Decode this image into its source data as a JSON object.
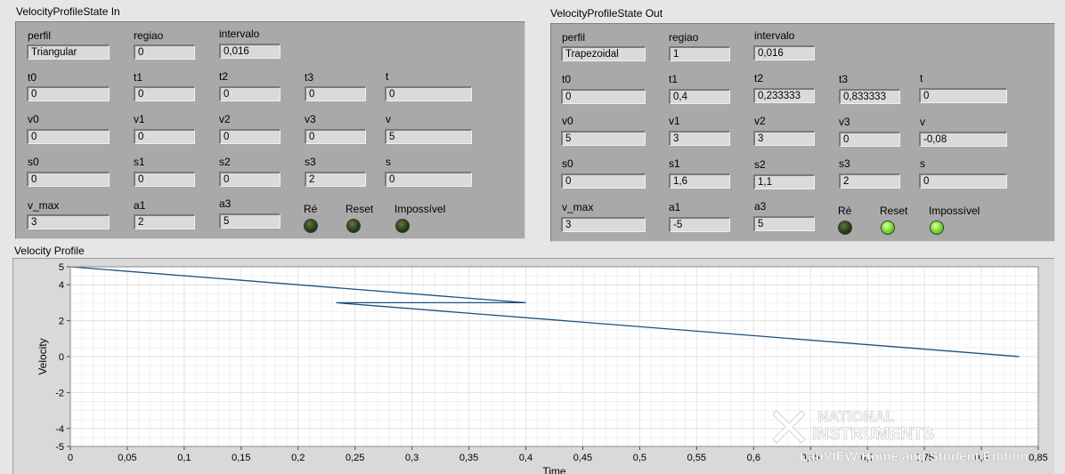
{
  "in": {
    "title": "VelocityProfileState In",
    "labels": {
      "perfil": "perfil",
      "regiao": "regiao",
      "intervalo": "intervalo",
      "t0": "t0",
      "t1": "t1",
      "t2": "t2",
      "t3": "t3",
      "t": "t",
      "v0": "v0",
      "v1": "v1",
      "v2": "v2",
      "v3": "v3",
      "v": "v",
      "s0": "s0",
      "s1": "s1",
      "s2": "s2",
      "s3": "s3",
      "s": "s",
      "v_max": "v_max",
      "a1": "a1",
      "a3": "a3",
      "re": "Ré",
      "reset": "Reset",
      "impossivel": "Impossível"
    },
    "values": {
      "perfil": "Triangular",
      "regiao": "0",
      "intervalo": "0,016",
      "t0": "0",
      "t1": "0",
      "t2": "0",
      "t3": "0",
      "t": "0",
      "v0": "0",
      "v1": "0",
      "v2": "0",
      "v3": "0",
      "v": "5",
      "s0": "0",
      "s1": "0",
      "s2": "0",
      "s3": "2",
      "s": "0",
      "v_max": "3",
      "a1": "2",
      "a3": "5"
    },
    "leds": {
      "re": false,
      "reset": false,
      "impossivel": false
    }
  },
  "out": {
    "title": "VelocityProfileState Out",
    "labels": {
      "perfil": "perfil",
      "regiao": "regiao",
      "intervalo": "intervalo",
      "t0": "t0",
      "t1": "t1",
      "t2": "t2",
      "t3": "t3",
      "t": "t",
      "v0": "v0",
      "v1": "v1",
      "v2": "v2",
      "v3": "v3",
      "v": "v",
      "s0": "s0",
      "s1": "s1",
      "s2": "s2",
      "s3": "s3",
      "s": "s",
      "v_max": "v_max",
      "a1": "a1",
      "a3": "a3",
      "re": "Ré",
      "reset": "Reset",
      "impossivel": "Impossível"
    },
    "values": {
      "perfil": "Trapezoidal",
      "regiao": "1",
      "intervalo": "0,016",
      "t0": "0",
      "t1": "0,4",
      "t2": "0,233333",
      "t3": "0,833333",
      "t": "0",
      "v0": "5",
      "v1": "3",
      "v2": "3",
      "v3": "0",
      "v": "-0,08",
      "s0": "0",
      "s1": "1,6",
      "s2": "1,1",
      "s3": "2",
      "s": "0",
      "v_max": "3",
      "a1": "-5",
      "a3": "5"
    },
    "leds": {
      "re": false,
      "reset": true,
      "impossivel": true
    }
  },
  "graph": {
    "title": "Velocity Profile",
    "ylabel": "Velocity",
    "xlabel": "Time",
    "watermark_line1": "NATIONAL",
    "watermark_line2": "INSTRUMENTS",
    "watermark_line3": "LabVIEW Home and Student Edition",
    "colors": {
      "plot": "#1f4f82",
      "background": "#ffffff",
      "grid": "#e3e3e3",
      "minor_grid": "#f1f1f1"
    }
  },
  "chart_data": {
    "type": "line",
    "title": "Velocity Profile",
    "xlabel": "Time",
    "ylabel": "Velocity",
    "xlim": [
      0,
      0.85
    ],
    "ylim": [
      -5,
      5
    ],
    "xticks": [
      0,
      0.05,
      0.1,
      0.15,
      0.2,
      0.25,
      0.3,
      0.35,
      0.4,
      0.45,
      0.5,
      0.55,
      0.6,
      0.65,
      0.7,
      0.75,
      0.8,
      0.85
    ],
    "xtick_labels": [
      "0",
      "0,05",
      "0,1",
      "0,15",
      "0,2",
      "0,25",
      "0,3",
      "0,35",
      "0,4",
      "0,45",
      "0,5",
      "0,55",
      "0,6",
      "0,65",
      "0,7",
      "0,75",
      "0,8",
      "0,85"
    ],
    "yticks": [
      5,
      4,
      2,
      0,
      -2,
      -4,
      -5
    ],
    "ytick_labels": [
      "5",
      "4",
      "2",
      "0",
      "-2",
      "-4",
      "-5"
    ],
    "grid": true,
    "series": [
      {
        "x": [
          0,
          0.4,
          0.233333,
          0.833333
        ],
        "y": [
          5,
          3,
          3,
          0
        ]
      }
    ]
  }
}
